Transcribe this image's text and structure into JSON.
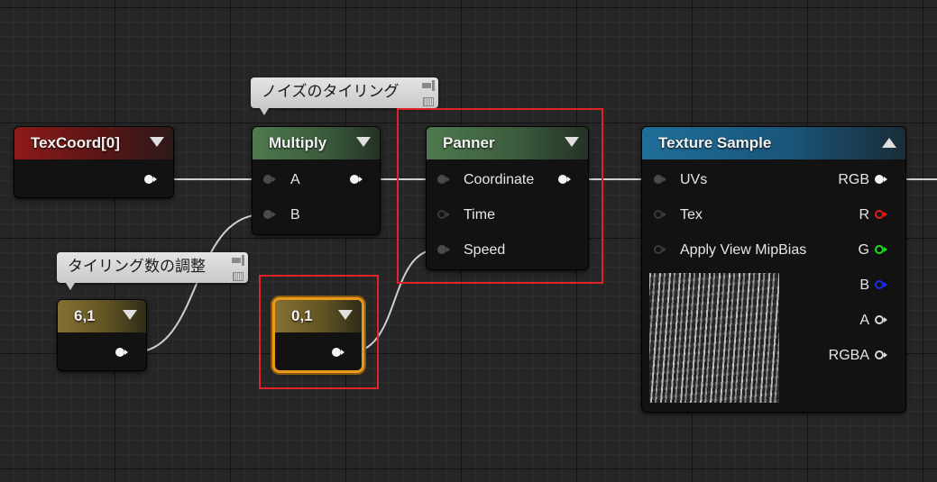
{
  "comments": {
    "tiling": "ノイズのタイリング",
    "tiling_amount": "タイリング数の調整"
  },
  "nodes": {
    "texcoord": {
      "title": "TexCoord[0]"
    },
    "multiply": {
      "title": "Multiply",
      "inputs": [
        "A",
        "B"
      ]
    },
    "panner": {
      "title": "Panner",
      "inputs": [
        "Coordinate",
        "Time",
        "Speed"
      ]
    },
    "texture_sample": {
      "title": "Texture Sample",
      "inputs": [
        "UVs",
        "Tex",
        "Apply View MipBias"
      ],
      "outputs": [
        "RGB",
        "R",
        "G",
        "B",
        "A",
        "RGBA"
      ]
    },
    "const_tiling": {
      "title": "6,1"
    },
    "const_speed": {
      "title": "0,1"
    }
  },
  "colors": {
    "highlight": "#e0232b",
    "selected": "#e89a1a",
    "pin_r": "#e21b1b",
    "pin_g": "#1ee01e",
    "pin_b": "#1a2fe6"
  },
  "icons": {
    "collapse": "triangle-down-icon",
    "expand": "triangle-up-icon",
    "comment_pin": "pin-icon"
  }
}
